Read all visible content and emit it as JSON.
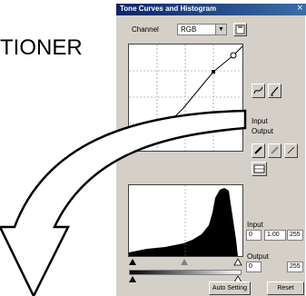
{
  "background_text": "TIONER",
  "window": {
    "title": "Tone Curves and Histogram",
    "close_glyph": "×",
    "channel_label": "Channel",
    "channel_value": "RGB",
    "dropdown_glyph": "▼",
    "input_label": "Input",
    "output_label": "Output",
    "levels": {
      "input_label": "Input",
      "input_black": "0",
      "input_gamma": "1.00",
      "input_white": "255",
      "output_label": "Output",
      "output_black": "0",
      "output_white": "255"
    },
    "buttons": {
      "auto_setting": "Auto Setting",
      "reset": "Reset"
    }
  },
  "colors": {
    "titlebar": "#0a246a",
    "dialog_bg": "#d4d0c8",
    "arrow_stroke": "#000000"
  }
}
